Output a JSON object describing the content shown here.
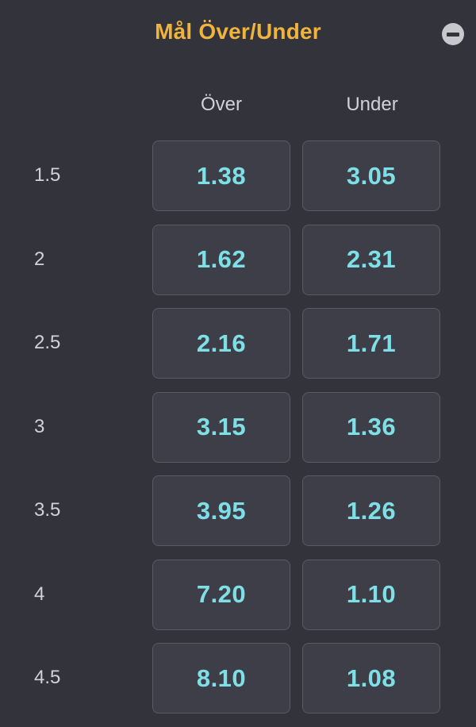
{
  "market": {
    "title": "Mål Över/Under",
    "collapse_icon": "minus-circle-icon",
    "colors": {
      "title": "#f0b43c",
      "odds": "#7ee0e6",
      "background": "#33333c",
      "button_bg": "#3e3e48"
    }
  },
  "columns": {
    "over": "Över",
    "under": "Under"
  },
  "rows": [
    {
      "line": "1.5",
      "over": "1.38",
      "under": "3.05"
    },
    {
      "line": "2",
      "over": "1.62",
      "under": "2.31"
    },
    {
      "line": "2.5",
      "over": "2.16",
      "under": "1.71"
    },
    {
      "line": "3",
      "over": "3.15",
      "under": "1.36"
    },
    {
      "line": "3.5",
      "over": "3.95",
      "under": "1.26"
    },
    {
      "line": "4",
      "over": "7.20",
      "under": "1.10"
    },
    {
      "line": "4.5",
      "over": "8.10",
      "under": "1.08"
    }
  ]
}
